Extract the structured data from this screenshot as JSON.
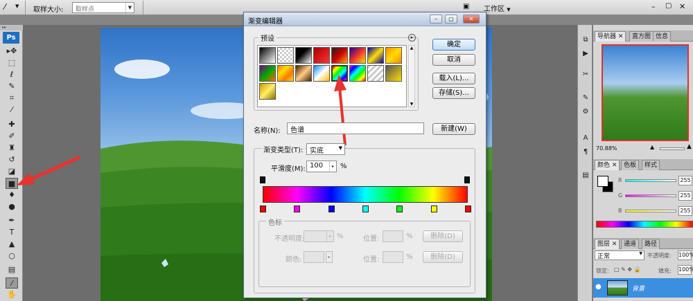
{
  "options_bar": {
    "sample_size_label": "取样大小:",
    "sample_size_value": "取样点",
    "workspace_label": "工作区"
  },
  "toolbar": {
    "logo": "Ps",
    "tools": [
      {
        "name": "move-tool",
        "glyph": "▸✥"
      },
      {
        "name": "marquee-tool",
        "glyph": "⬚"
      },
      {
        "name": "lasso-tool",
        "glyph": "ℓ"
      },
      {
        "name": "quick-select-tool",
        "glyph": "✎"
      },
      {
        "name": "crop-tool",
        "glyph": "⌗"
      },
      {
        "name": "eyedropper-tool",
        "glyph": "⁄"
      },
      {
        "name": "healing-tool",
        "glyph": "✚"
      },
      {
        "name": "brush-tool",
        "glyph": "✐"
      },
      {
        "name": "stamp-tool",
        "glyph": "♜"
      },
      {
        "name": "history-brush-tool",
        "glyph": "↺"
      },
      {
        "name": "eraser-tool",
        "glyph": "◪"
      },
      {
        "name": "gradient-tool",
        "glyph": "■"
      },
      {
        "name": "blur-tool",
        "glyph": "♦"
      },
      {
        "name": "dodge-tool",
        "glyph": "●"
      },
      {
        "name": "pen-tool",
        "glyph": "✒"
      },
      {
        "name": "type-tool",
        "glyph": "T"
      },
      {
        "name": "path-select-tool",
        "glyph": "▲"
      },
      {
        "name": "shape-tool",
        "glyph": "○"
      },
      {
        "name": "notes-tool",
        "glyph": "▤"
      },
      {
        "name": "eyedropper-tool-2",
        "glyph": "⁄"
      },
      {
        "name": "hand-tool",
        "glyph": "✋"
      }
    ]
  },
  "dialog": {
    "title": "渐变编辑器",
    "presets_label": "预设",
    "buttons": {
      "ok": "确定",
      "cancel": "取消",
      "load": "载入(L)...",
      "save": "存储(S)...",
      "new": "新建(W)"
    },
    "name_label": "名称(N):",
    "name_value": "色谱",
    "gradient_type_label": "渐变类型(T):",
    "gradient_type_value": "实底",
    "smoothness_label": "平滑度(M):",
    "smoothness_value": "100",
    "smoothness_unit": "%",
    "stops_group_label": "色标",
    "opacity_label": "不透明度:",
    "color_label": "颜色:",
    "position_label": "位置:",
    "percent": "%",
    "delete_label": "删除(D)",
    "spectrum_stops": [
      "#ff0000",
      "#ff00ff",
      "#0000ff",
      "#00ffff",
      "#00ff00",
      "#ffff00",
      "#ff0000"
    ]
  },
  "panels": {
    "nav_tabs": [
      "导航器",
      "直方图",
      "信息"
    ],
    "zoom": "70.88%",
    "color_tabs": [
      "颜色",
      "色板",
      "样式"
    ],
    "channels": [
      {
        "label": "R",
        "value": "255"
      },
      {
        "label": "G",
        "value": "255"
      },
      {
        "label": "B",
        "value": "255"
      }
    ],
    "layer_tabs": [
      "图层",
      "通道",
      "路径"
    ],
    "blend_mode": "正常",
    "opacity_label": "不透明度:",
    "opacity_value": "100%",
    "lock_label": "锁定:",
    "fill_label": "填充:",
    "fill_value": "100%",
    "layer_name": "背景"
  },
  "colors": {
    "arrow": "#e8322e",
    "layer_highlight": "#3b8fe0"
  }
}
